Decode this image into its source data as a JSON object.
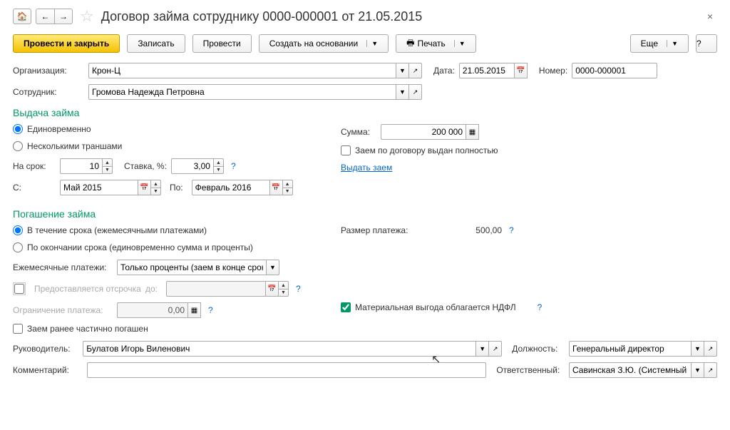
{
  "header": {
    "title": "Договор займа сотруднику 0000-000001 от 21.05.2015"
  },
  "toolbar": {
    "post_close": "Провести и закрыть",
    "save": "Записать",
    "post": "Провести",
    "create_based": "Создать на основании",
    "print": "Печать",
    "more": "Еще",
    "help": "?"
  },
  "fields": {
    "org_label": "Организация:",
    "org_value": "Крон-Ц",
    "date_label": "Дата:",
    "date_value": "21.05.2015",
    "number_label": "Номер:",
    "number_value": "0000-000001",
    "employee_label": "Сотрудник:",
    "employee_value": "Громова Надежда Петровна"
  },
  "loan_issue": {
    "title": "Выдача займа",
    "opt_once": "Единовременно",
    "opt_tranches": "Несколькими траншами",
    "amount_label": "Сумма:",
    "amount_value": "200 000",
    "fully_issued": "Заем по договору выдан полностью",
    "term_label": "На срок:",
    "term_value": "10",
    "rate_label": "Ставка, %:",
    "rate_value": "3,00",
    "issue_link": "Выдать заем",
    "from_label": "C:",
    "from_value": "Май 2015",
    "to_label": "По:",
    "to_value": "Февраль 2016"
  },
  "repayment": {
    "title": "Погашение займа",
    "opt_during": "В течение срока (ежемесячными платежами)",
    "opt_end": "По окончании срока (единовременно сумма и проценты)",
    "payment_size_label": "Размер платежа:",
    "payment_size_value": "500,00",
    "monthly_label": "Ежемесячные платежи:",
    "monthly_value": "Только проценты (заем в конце срока)",
    "deferral_label": "Предоставляется отсрочка",
    "deferral_to": "до:",
    "limit_label": "Ограничение платежа:",
    "limit_value": "0,00",
    "benefit_tax": "Материальная выгода облагается НДФЛ",
    "partially_repaid": "Заем ранее частично погашен"
  },
  "footer": {
    "manager_label": "Руководитель:",
    "manager_value": "Булатов Игорь Виленович",
    "position_label": "Должность:",
    "position_value": "Генеральный директор",
    "comment_label": "Комментарий:",
    "responsible_label": "Ответственный:",
    "responsible_value": "Савинская З.Ю. (Системный прог"
  }
}
